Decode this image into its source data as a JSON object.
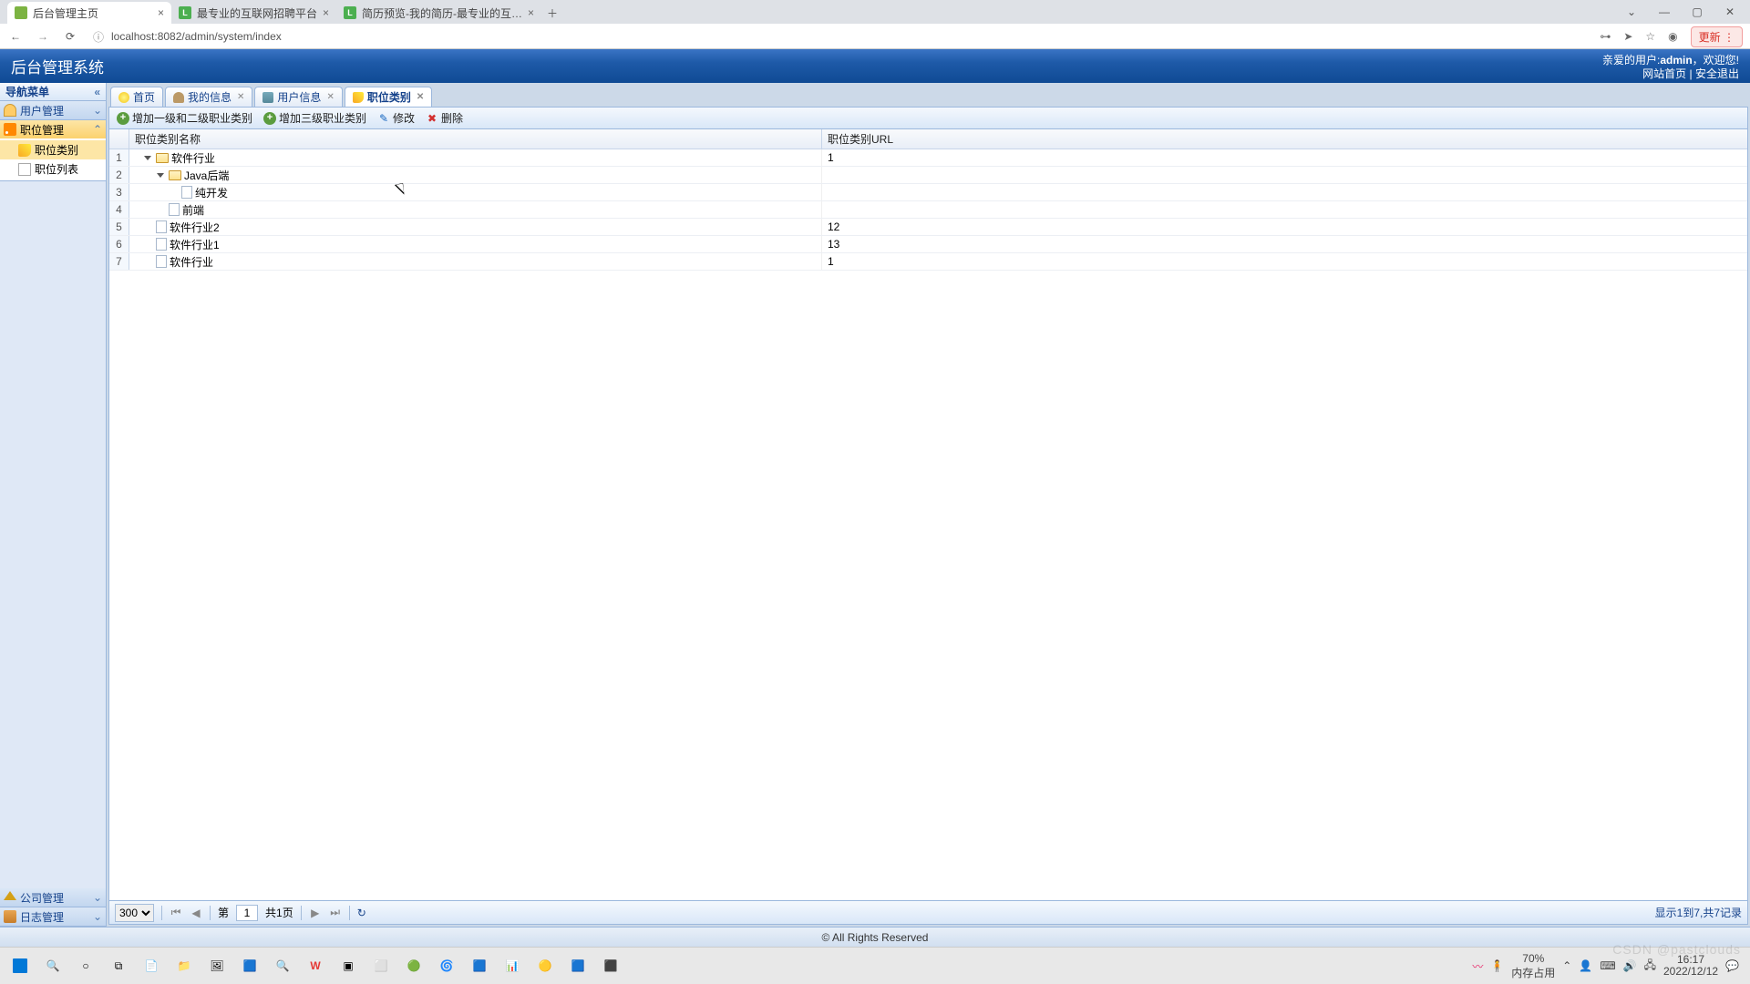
{
  "browser": {
    "tabs": [
      {
        "title": "后台管理主页",
        "active": true,
        "favicon": "green"
      },
      {
        "title": "最专业的互联网招聘平台",
        "active": false,
        "favicon": "L"
      },
      {
        "title": "简历预览-我的简历-最专业的互…",
        "active": false,
        "favicon": "L"
      }
    ],
    "url": "localhost:8082/admin/system/index",
    "update_label": "更新"
  },
  "header": {
    "app_title": "后台管理系统",
    "welcome_prefix": "亲爱的用户:",
    "username": "admin",
    "welcome_suffix": "，欢迎您!",
    "link_home": "网站首页",
    "link_logout": "安全退出"
  },
  "sidebar": {
    "title": "导航菜单",
    "panels": [
      {
        "name": "用户管理",
        "icon": "ico-user",
        "expanded": false
      },
      {
        "name": "职位管理",
        "icon": "ico-rss",
        "expanded": true,
        "items": [
          {
            "label": "职位类别",
            "selected": true,
            "icon": "ico-tag"
          },
          {
            "label": "职位列表",
            "selected": false,
            "icon": "ico-page"
          }
        ]
      },
      {
        "name": "公司管理",
        "icon": "ico-home",
        "expanded": false,
        "bottom": true
      },
      {
        "name": "日志管理",
        "icon": "ico-build",
        "expanded": false,
        "bottom": true
      }
    ]
  },
  "tabs": [
    {
      "label": "首页",
      "icon": "ico-bulb",
      "closable": false,
      "active": false
    },
    {
      "label": "我的信息",
      "icon": "ico-person",
      "closable": true,
      "active": false
    },
    {
      "label": "用户信息",
      "icon": "ico-people",
      "closable": true,
      "active": false
    },
    {
      "label": "职位类别",
      "icon": "ico-tag",
      "closable": true,
      "active": true
    }
  ],
  "toolbar": {
    "btn_add12": "增加一级和二级职业类别",
    "btn_add3": "增加三级职业类别",
    "btn_edit": "修改",
    "btn_delete": "删除"
  },
  "grid": {
    "col_name": "职位类别名称",
    "col_url": "职位类别URL",
    "rows": [
      {
        "n": "1",
        "indent": 0,
        "arrow": "open",
        "icon": "folder-open",
        "label": "软件行业",
        "url": "1"
      },
      {
        "n": "2",
        "indent": 1,
        "arrow": "open",
        "icon": "folder-open",
        "label": "Java后端",
        "url": ""
      },
      {
        "n": "3",
        "indent": 2,
        "arrow": "blank",
        "icon": "leaf",
        "label": "纯开发",
        "url": ""
      },
      {
        "n": "4",
        "indent": 1,
        "arrow": "blank",
        "icon": "leaf",
        "label": "前端",
        "url": ""
      },
      {
        "n": "5",
        "indent": 0,
        "arrow": "blank",
        "icon": "leaf",
        "label": "软件行业2",
        "url": "12"
      },
      {
        "n": "6",
        "indent": 0,
        "arrow": "blank",
        "icon": "leaf",
        "label": "软件行业1",
        "url": "13"
      },
      {
        "n": "7",
        "indent": 0,
        "arrow": "blank",
        "icon": "leaf",
        "label": "软件行业",
        "url": "1"
      }
    ]
  },
  "paging": {
    "page_size": "300",
    "page_prefix": "第",
    "page_value": "1",
    "total_pages": "共1页",
    "summary": "显示1到7,共7记录"
  },
  "footer": {
    "copyright": "© All Rights Reserved"
  },
  "taskbar": {
    "battery_pct": "70%",
    "battery_label": "内存占用",
    "time": "16:17",
    "date": "2022/12/12"
  },
  "watermark": "CSDN @pastclouds"
}
